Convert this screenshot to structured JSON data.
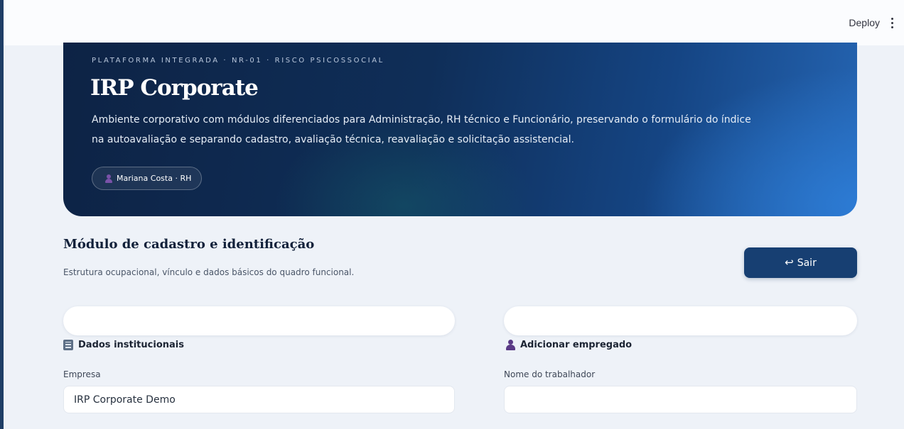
{
  "header": {
    "deploy_label": "Deploy",
    "menu_icon": "kebab-menu-icon"
  },
  "hero": {
    "eyebrow": "PLATAFORMA INTEGRADA · NR-01 · RISCO PSICOSSOCIAL",
    "title": "IRP Corporate",
    "description": "Ambiente corporativo com módulos diferenciados para Administração, RH técnico e Funcionário, preservando o formulário do índice na autoavaliação e separando cadastro, avaliação técnica, reavaliação e solicitação assistencial.",
    "user_label": "Mariana Costa · RH"
  },
  "section": {
    "title": "Módulo de cadastro e identificação",
    "subtitle": "Estrutura ocupacional, vínculo e dados básicos do quadro funcional.",
    "exit_label": "Sair"
  },
  "left_column": {
    "heading": "Dados institucionais",
    "field_label": "Empresa",
    "field_value": "IRP Corporate Demo"
  },
  "right_column": {
    "heading": "Adicionar empregado",
    "field_label": "Nome do trabalhador",
    "field_value": ""
  },
  "colors": {
    "hero_dark": "#0d2345",
    "hero_light": "#2565b3",
    "button": "#173f72",
    "background": "#eef2f8",
    "person_icon": "#5a3a86"
  }
}
